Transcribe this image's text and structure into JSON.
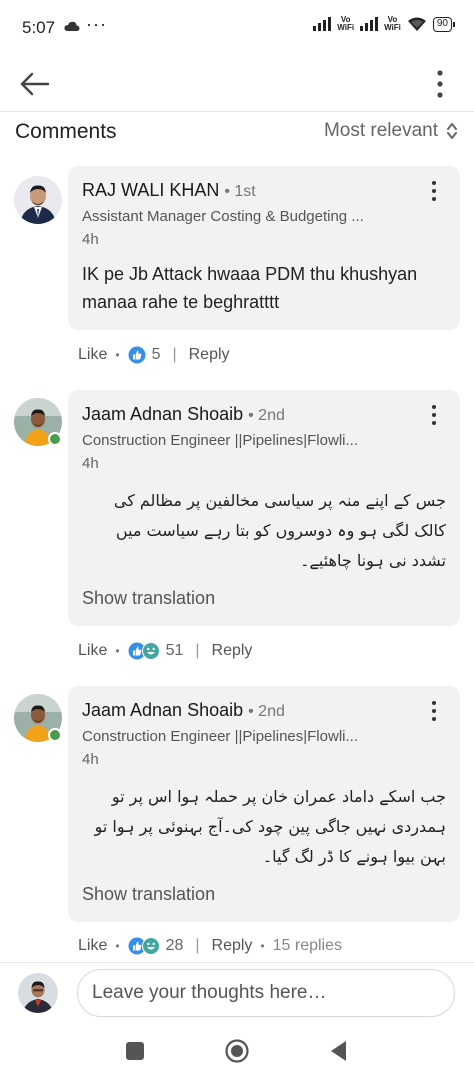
{
  "status_bar": {
    "time": "5:07",
    "more": "···",
    "vowifi_1": "Vo\nWiFi",
    "vowifi_2": "Vo\nWiFi",
    "battery": "90"
  },
  "header": {
    "back_icon": "arrow-left-icon",
    "menu_icon": "more-vertical-icon"
  },
  "comments_section": {
    "title": "Comments",
    "sort_label": "Most relevant"
  },
  "comments": [
    {
      "author": "RAJ WALI KHAN",
      "degree": "• 1st",
      "headline": "Assistant Manager Costing & Budgeting ...",
      "time": "4h",
      "text": "IK pe Jb Attack hwaaa PDM thu khushyan manaa rahe te beghratttt",
      "like_label": "Like",
      "reaction_count": "5",
      "reply_label": "Reply"
    },
    {
      "author": "Jaam Adnan Shoaib",
      "degree": "• 2nd",
      "headline": "Construction Engineer ||Pipelines|Flowli...",
      "time": "4h",
      "text": "جس کے اپنے منہ پر سیاسی مخالفین پر مظالم کی کالک لگی ہو وہ دوسروں کو بتا رہے سیاست میں تشدد نی ہونا چاھئیے۔",
      "show_translation": "Show translation",
      "like_label": "Like",
      "reaction_count": "51",
      "reply_label": "Reply"
    },
    {
      "author": "Jaam Adnan Shoaib",
      "degree": "• 2nd",
      "headline": "Construction Engineer ||Pipelines|Flowli...",
      "time": "4h",
      "text": "جب اسکے داماد عمران خان پر حملہ ہوا اس پر تو ہمدردی نہیں جاگی پین چود کی۔آج بہنوئی پر ہوا تو بہن بیوا ہونے کا ڈر لگ گیا۔",
      "show_translation": "Show translation",
      "like_label": "Like",
      "reaction_count": "28",
      "reply_label": "Reply",
      "replies_count": "15 replies"
    }
  ],
  "composer": {
    "placeholder": "Leave your thoughts here…"
  },
  "colors": {
    "accent_blue": "#378fe9",
    "bubble_bg": "#f2f2f2",
    "online_green": "#4a9a52",
    "smile_teal": "#44a6a0"
  }
}
